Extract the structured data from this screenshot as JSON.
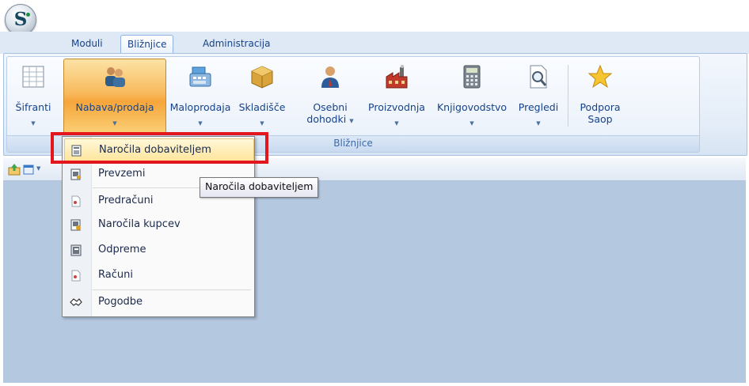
{
  "app": {
    "logo_letter": "S"
  },
  "tabs": [
    {
      "label": "Moduli",
      "active": false
    },
    {
      "label": "Bližnjice",
      "active": true
    },
    {
      "label": "Administracija",
      "active": false
    }
  ],
  "ribbon": {
    "group_label": "Bližnjice",
    "buttons": [
      {
        "label": "Šifranti",
        "icon": "table-grid-icon",
        "has_dropdown": true
      },
      {
        "label": "Nabava/prodaja",
        "icon": "people-icon",
        "has_dropdown": true,
        "pressed": true
      },
      {
        "label": "Maloprodaja",
        "icon": "cash-register-icon",
        "has_dropdown": true
      },
      {
        "label": "Skladišče",
        "icon": "boxes-icon",
        "has_dropdown": true
      },
      {
        "label": "Osebni dohodki",
        "label_line1": "Osebni",
        "label_line2": "dohodki",
        "icon": "person-icon",
        "has_dropdown": true
      },
      {
        "label": "Proizvodnja",
        "icon": "factory-icon",
        "has_dropdown": true
      },
      {
        "label": "Knjigovodstvo",
        "icon": "calculator-icon",
        "has_dropdown": true
      },
      {
        "label": "Pregledi",
        "icon": "document-search-icon",
        "has_dropdown": true
      },
      {
        "label": "Podpora Saop",
        "label_line1": "Podpora",
        "label_line2": "Saop",
        "icon": "star-icon",
        "has_dropdown": false
      }
    ]
  },
  "dropdown_menu": {
    "items": [
      {
        "label": "Naročila dobaviteljem",
        "icon": "order-icon",
        "highlighted": true
      },
      {
        "label": "Prevzemi",
        "icon": "receipt-icon"
      },
      {
        "label": "Predračuni",
        "icon": "quote-icon"
      },
      {
        "label": "Naročila kupcev",
        "icon": "customer-order-icon"
      },
      {
        "label": "Odpreme",
        "icon": "dispatch-icon"
      },
      {
        "label": "Računi",
        "icon": "invoice-icon"
      },
      {
        "label": "Pogodbe",
        "icon": "contract-handshake-icon"
      }
    ]
  },
  "tooltip": {
    "text": "Naročila dobaviteljem"
  },
  "colors": {
    "accent": "#f8b85a",
    "highlight_frame": "#e3161d",
    "workspace": "#b4c8e0",
    "tab_text": "#15428b"
  }
}
